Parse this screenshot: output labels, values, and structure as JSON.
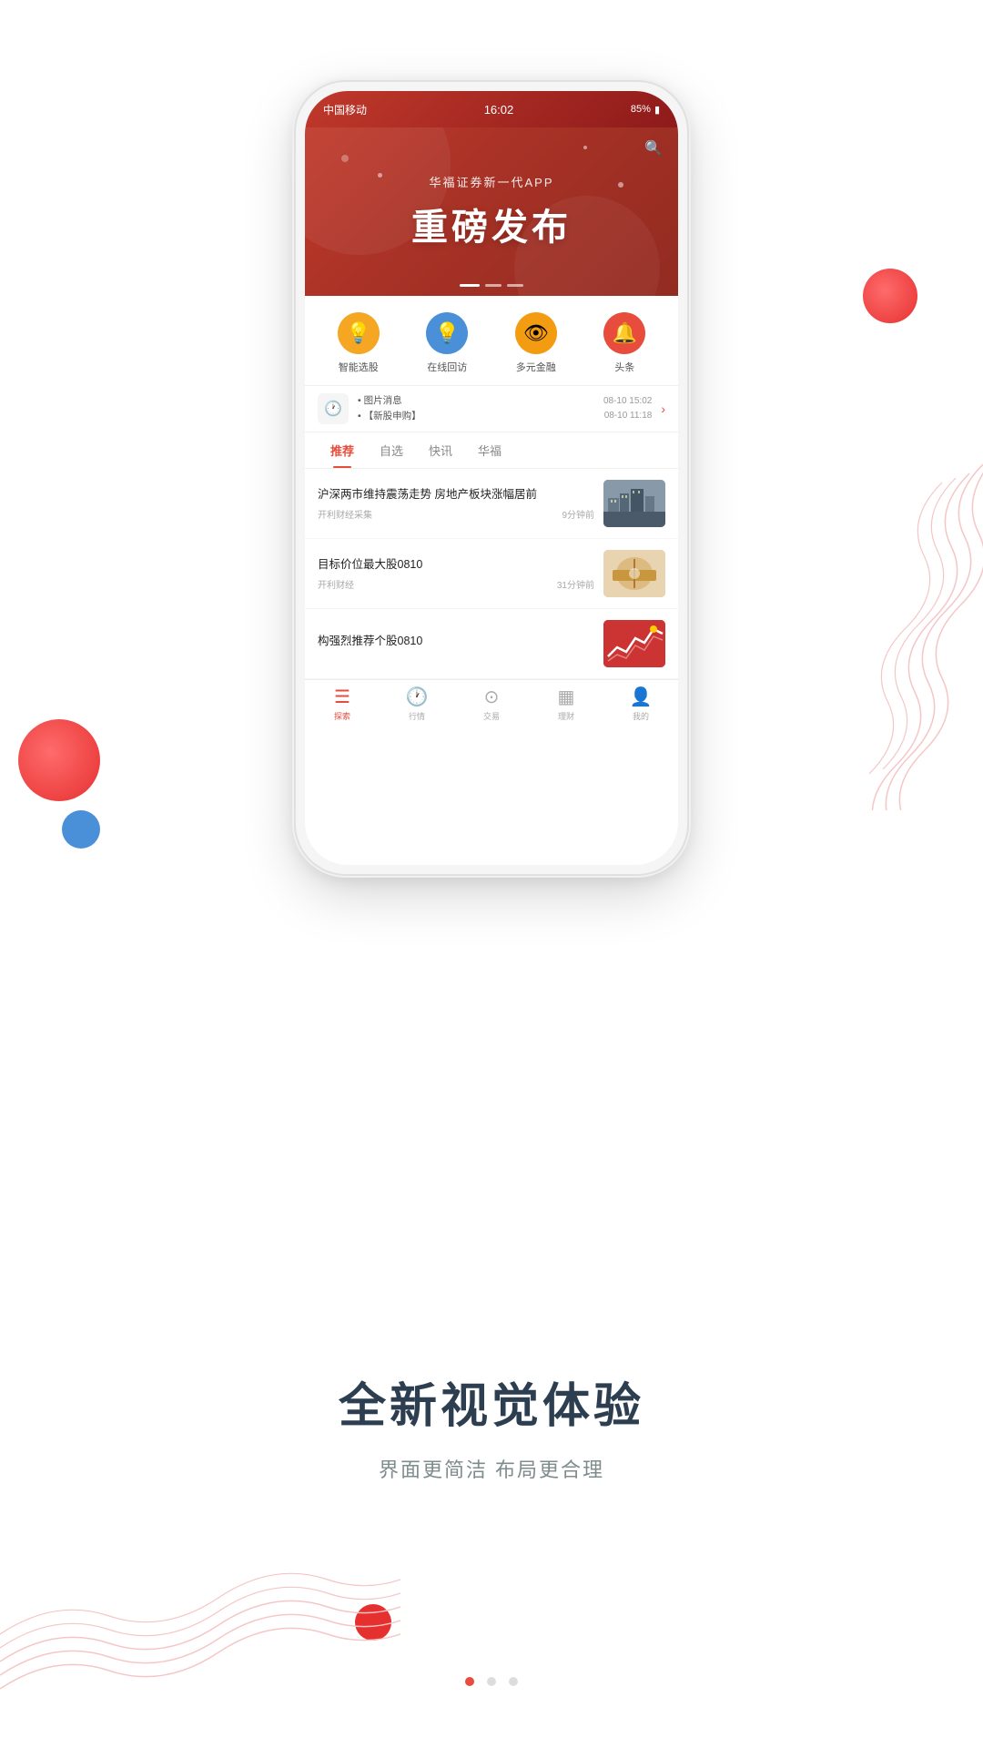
{
  "statusBar": {
    "carrier": "中国移动",
    "time": "16:02",
    "battery": "85%"
  },
  "heroBanner": {
    "subtitle": "华福证券新一代APP",
    "title": "重磅发布"
  },
  "quickMenu": [
    {
      "label": "智能选股",
      "iconColor": "yellow",
      "icon": "💡"
    },
    {
      "label": "在线回访",
      "iconColor": "blue",
      "icon": "💡"
    },
    {
      "label": "多元金融",
      "iconColor": "amber",
      "icon": "👁"
    },
    {
      "label": "头条",
      "iconColor": "red",
      "icon": "🔔"
    }
  ],
  "newsTicker": {
    "items": [
      {
        "text": "• 图片消息",
        "time": "08-10 15:02"
      },
      {
        "text": "• 【新股申购】",
        "time": "08-10 11:18"
      }
    ]
  },
  "tabs": [
    {
      "label": "推荐",
      "active": true
    },
    {
      "label": "自选",
      "active": false
    },
    {
      "label": "快讯",
      "active": false
    },
    {
      "label": "华福",
      "active": false
    }
  ],
  "newsList": [
    {
      "title": "沪深两市维持震荡走势 房地产板块涨幅居前",
      "source": "开利财经采集",
      "time": "9分钟前",
      "imgType": "buildings"
    },
    {
      "title": "目标价位最大股0810",
      "source": "开利财经",
      "time": "31分钟前",
      "imgType": "finance"
    },
    {
      "title": "构强烈推荐个股0810",
      "source": "",
      "time": "",
      "imgType": "stock"
    }
  ],
  "bottomNav": [
    {
      "label": "探索",
      "active": true,
      "icon": "☰"
    },
    {
      "label": "行情",
      "active": false,
      "icon": "🕐"
    },
    {
      "label": "交易",
      "active": false,
      "icon": "⊙"
    },
    {
      "label": "理财",
      "active": false,
      "icon": "▦"
    },
    {
      "label": "我的",
      "active": false,
      "icon": "👤"
    }
  ],
  "bottomSection": {
    "title": "全新视觉体验",
    "subtitle": "界面更简洁 布局更合理"
  },
  "pageDots": [
    {
      "active": true
    },
    {
      "active": false
    },
    {
      "active": false
    }
  ]
}
